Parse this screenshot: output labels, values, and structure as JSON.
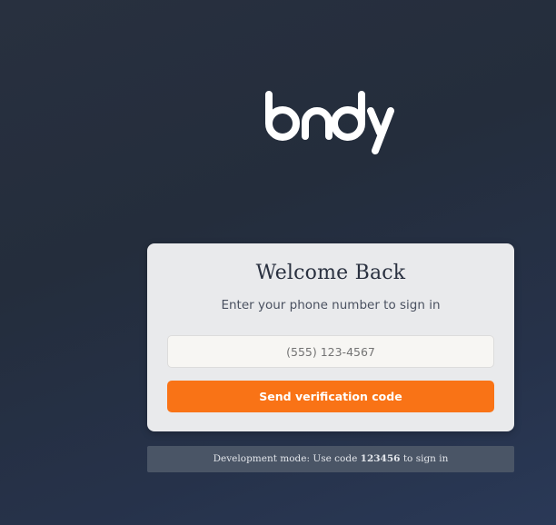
{
  "brand": {
    "logo_text": "bndy"
  },
  "login_card": {
    "title": "Welcome Back",
    "subtitle": "Enter your phone number to sign in",
    "phone_placeholder": "(555) 123-4567",
    "phone_value": "",
    "submit_label": "Send verification code"
  },
  "dev_notice": {
    "prefix": "Development mode: Use code ",
    "code": "123456",
    "suffix": " to sign in"
  },
  "colors": {
    "accent": "#f97316",
    "background": "#242d3c",
    "card": "#e9eaec"
  }
}
